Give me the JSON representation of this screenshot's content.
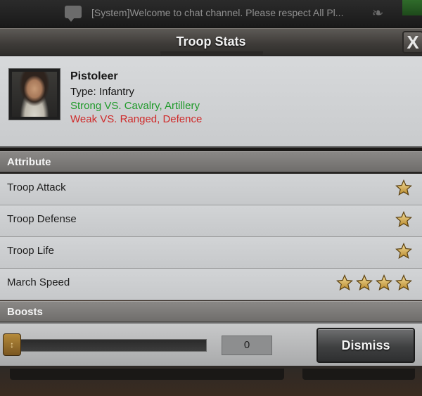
{
  "chat": {
    "message": "[System]Welcome to chat channel. Please respect All Pl...",
    "chat_icon": "chat-bubble-icon",
    "right_icon": "bird-icon"
  },
  "header": {
    "title": "Troop Stats",
    "close_label": "X"
  },
  "unit": {
    "name": "Pistoleer",
    "type": "Type: Infantry",
    "strong": "Strong VS. Cavalry, Artillery",
    "weak": "Weak VS. Ranged, Defence",
    "strong_color": "#1f9a2a",
    "weak_color": "#cf2a2a"
  },
  "sections": {
    "attribute": "Attribute",
    "boosts": "Boosts"
  },
  "attributes": [
    {
      "label": "Troop Attack",
      "stars": 1
    },
    {
      "label": "Troop Defense",
      "stars": 1
    },
    {
      "label": "Troop Life",
      "stars": 1
    },
    {
      "label": "March Speed",
      "stars": 4
    }
  ],
  "footer": {
    "slider_value": "0",
    "dismiss_label": "Dismiss"
  }
}
